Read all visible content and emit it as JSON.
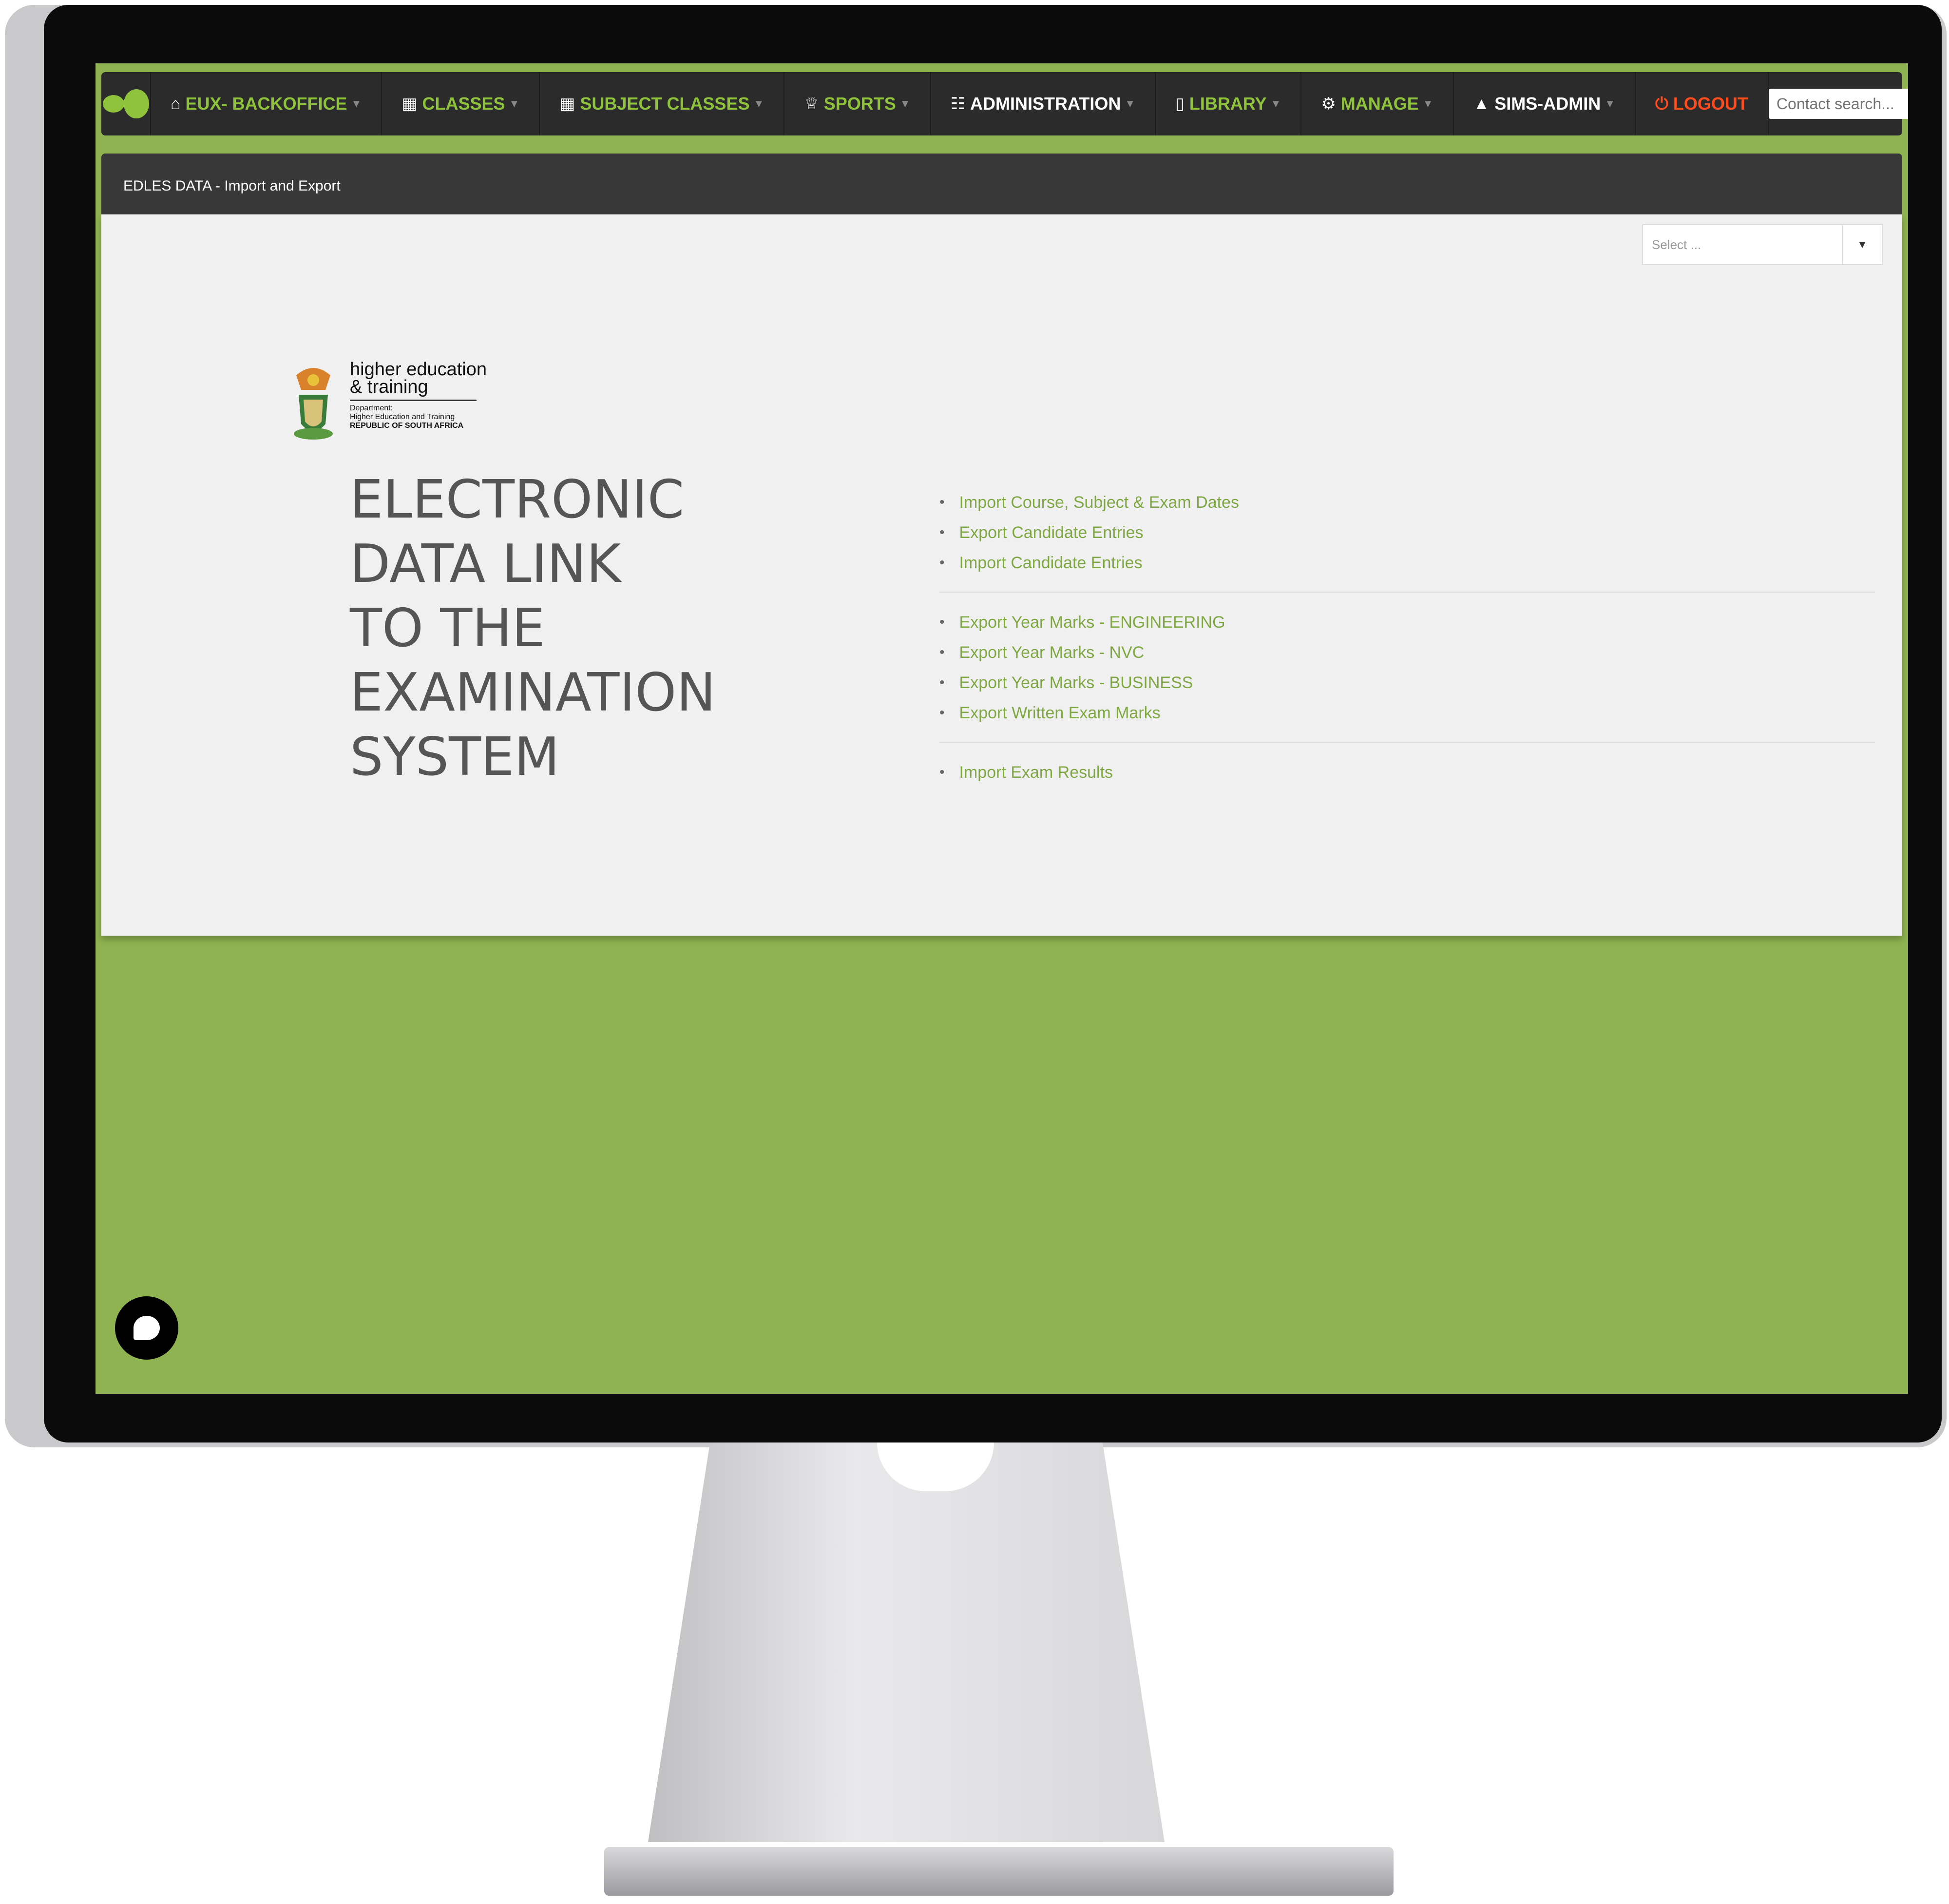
{
  "nav": {
    "items": [
      {
        "label": "EUX- BACKOFFICE",
        "icon": "home-icon",
        "caret": true,
        "color": "green"
      },
      {
        "label": "CLASSES",
        "icon": "grid-icon",
        "caret": true,
        "color": "green"
      },
      {
        "label": "SUBJECT CLASSES",
        "icon": "grid-icon",
        "caret": true,
        "color": "green"
      },
      {
        "label": "SPORTS",
        "icon": "trophy-icon",
        "caret": true,
        "color": "green"
      },
      {
        "label": "ADMINISTRATION",
        "icon": "sitemap-icon",
        "caret": true,
        "color": "white"
      },
      {
        "label": "LIBRARY",
        "icon": "book-icon",
        "caret": true,
        "color": "green"
      },
      {
        "label": "MANAGE",
        "icon": "gears-icon",
        "caret": true,
        "color": "green"
      },
      {
        "label": "SIMS-ADMIN",
        "icon": "user-icon",
        "caret": true,
        "color": "white"
      },
      {
        "label": "LOGOUT",
        "icon": "power-icon",
        "caret": false,
        "color": "red"
      }
    ],
    "search_placeholder": "Contact search..."
  },
  "breadcrumb": "EDLES DATA - Import and Export",
  "select_placeholder": "Select ...",
  "department": {
    "line1": "higher education",
    "line2": "& training",
    "line3": "Department:",
    "line4": "Higher Education and Training",
    "line5": "REPUBLIC OF SOUTH AFRICA"
  },
  "title_lines": [
    "ELECTRONIC",
    "DATA LINK",
    "TO THE",
    "EXAMINATION",
    "SYSTEM"
  ],
  "link_groups": [
    [
      "Import Course, Subject & Exam Dates",
      "Export Candidate Entries",
      "Import Candidate Entries"
    ],
    [
      "Export Year Marks - ENGINEERING",
      "Export Year Marks - NVC",
      "Export Year Marks - BUSINESS",
      "Export Written Exam Marks"
    ],
    [
      "Import Exam Results"
    ]
  ],
  "colors": {
    "brand_green": "#8fb350",
    "nav_dark": "#2b2b2b",
    "link_green": "#7fa843",
    "logout_red": "#ff4c1f"
  }
}
